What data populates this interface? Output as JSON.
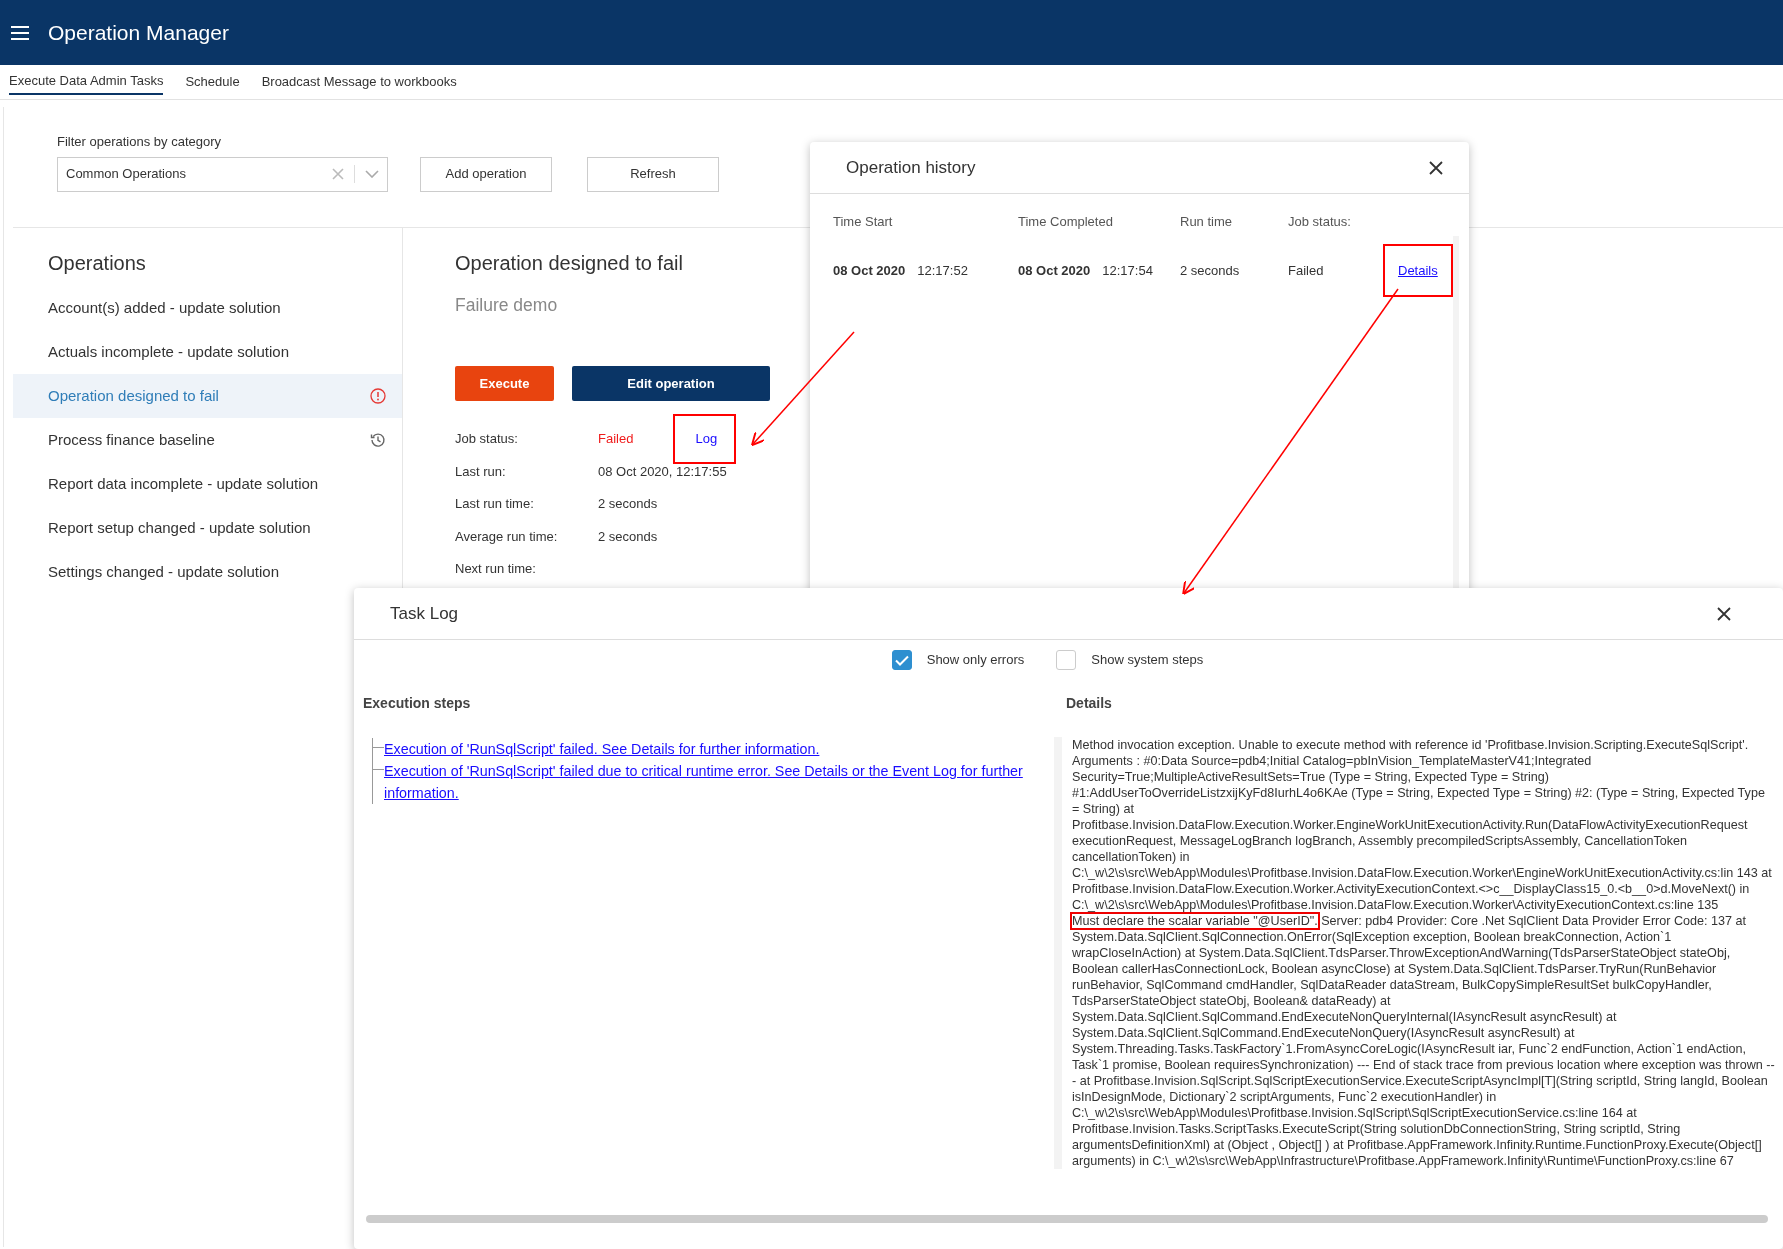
{
  "app": {
    "title": "Operation Manager"
  },
  "tabs": [
    {
      "label": "Execute Data Admin Tasks",
      "selected": true
    },
    {
      "label": "Schedule",
      "selected": false
    },
    {
      "label": "Broadcast Message to workbooks",
      "selected": false
    }
  ],
  "filter": {
    "label": "Filter operations by category",
    "value": "Common Operations"
  },
  "toolbar_buttons": [
    "Add operation",
    "Refresh"
  ],
  "operations": {
    "title": "Operations",
    "items": [
      {
        "label": "Account(s) added - update solution",
        "selected": false,
        "kind": "plain"
      },
      {
        "label": "Actuals incomplete - update solution",
        "selected": false,
        "kind": "plain"
      },
      {
        "label": "Operation designed to fail",
        "selected": true,
        "kind": "error"
      },
      {
        "label": "Process finance baseline",
        "selected": false,
        "kind": "history"
      },
      {
        "label": "Report data incomplete - update solution",
        "selected": false,
        "kind": "plain"
      },
      {
        "label": "Report setup changed - update solution",
        "selected": false,
        "kind": "plain"
      },
      {
        "label": "Settings changed - update solution",
        "selected": false,
        "kind": "plain"
      }
    ]
  },
  "detail": {
    "title": "Operation designed to fail",
    "subtitle": "Failure demo",
    "buttons": [
      {
        "label": "Execute",
        "kind": "danger"
      },
      {
        "label": "Edit operation",
        "kind": "primary"
      }
    ],
    "info": [
      {
        "label": "Job status:",
        "value": "Failed",
        "kind": "status"
      },
      {
        "label": "Last run:",
        "value": "08 Oct 2020, 12:17:55",
        "kind": "text"
      },
      {
        "label": "Last run time:",
        "value": "2 seconds",
        "kind": "text"
      },
      {
        "label": "Average run time:",
        "value": "2 seconds",
        "kind": "text"
      },
      {
        "label": "Next run time:",
        "kind": "text"
      }
    ],
    "log_link": {
      "label": "Log",
      "highlighted": true
    }
  },
  "history": {
    "title": "Operation history",
    "columns": [
      "Time Start",
      "Time Completed",
      "Run time",
      "Job status:"
    ],
    "rows": [
      {
        "start_date": "08 Oct 2020",
        "start_time": "12:17:52",
        "end_date": "08 Oct 2020",
        "end_time": "12:17:54",
        "run_time": "2 seconds",
        "status": "Failed",
        "link": "Details",
        "highlighted": true
      }
    ]
  },
  "task_log": {
    "title": "Task Log",
    "options": [
      {
        "label": "Show only errors",
        "checked": true
      },
      {
        "label": "Show system steps",
        "checked": false
      }
    ],
    "steps_title": "Execution steps",
    "steps": [
      "Execution of 'RunSqlScript' failed. See Details for further information.",
      "Execution of 'RunSqlScript' failed due to critical runtime error. See Details or the Event Log for further information."
    ],
    "details_title": "Details",
    "details": [
      {
        "text": "Method invocation exception. Unable to execute method with reference id 'Profitbase.Invision.Scripting.ExecuteSqlScript'. Arguments : #0:Data Source=pdb4;Initial Catalog=pbInVision_TemplateMasterV41;Integrated Security=True;MultipleActiveResultSets=True (Type = String, Expected Type = String) #1:AddUserToOverrideListzxijKyFd8IurhL4o6KAe (Type = String, Expected Type = String) #2: (Type = String, Expected Type = String) at Profitbase.Invision.DataFlow.Execution.Worker.EngineWorkUnitExecutionActivity.Run(DataFlowActivityExecutionRequest executionRequest, MessageLogBranch logBranch, Assembly precompiledScriptsAssembly, CancellationToken cancellationToken) in C:\\_w\\2\\s\\src\\WebApp\\Modules\\Profitbase.Invision.DataFlow.Execution.Worker\\EngineWorkUnitExecutionActivity.cs:lin 143 at Profitbase.Invision.DataFlow.Execution.Worker.ActivityExecutionContext.<>c__DisplayClass15_0.<b__0>d.MoveNext() in C:\\_w\\2\\s\\src\\WebApp\\Modules\\Profitbase.Invision.DataFlow.Execution.Worker\\ActivityExecutionContext.cs:line 135 ",
        "highlighted": false
      },
      {
        "text": "Must declare the scalar variable \"@UserID\".",
        "highlighted": true
      },
      {
        "text": " Server: pdb4 Provider: Core .Net SqlClient Data Provider Error Code: 137 at System.Data.SqlClient.SqlConnection.OnError(SqlException exception, Boolean breakConnection, Action`1 wrapCloseInAction) at System.Data.SqlClient.TdsParser.ThrowExceptionAndWarning(TdsParserStateObject stateObj, Boolean callerHasConnectionLock, Boolean asyncClose) at System.Data.SqlClient.TdsParser.TryRun(RunBehavior runBehavior, SqlCommand cmdHandler, SqlDataReader dataStream, BulkCopySimpleResultSet bulkCopyHandler, TdsParserStateObject stateObj, Boolean& dataReady) at System.Data.SqlClient.SqlCommand.EndExecuteNonQueryInternal(IAsyncResult asyncResult) at System.Data.SqlClient.SqlCommand.EndExecuteNonQuery(IAsyncResult asyncResult) at System.Threading.Tasks.TaskFactory`1.FromAsyncCoreLogic(IAsyncResult iar, Func`2 endFunction, Action`1 endAction, Task`1 promise, Boolean requiresSynchronization) --- End of stack trace from previous location where exception was thrown --- at Profitbase.Invision.SqlScript.SqlScriptExecutionService.ExecuteScriptAsyncImpl[T](String scriptId, String langId, Boolean isInDesignMode, Dictionary`2 scriptArguments, Func`2 executionHandler) in C:\\_w\\2\\s\\src\\WebApp\\Modules\\Profitbase.Invision.SqlScript\\SqlScriptExecutionService.cs:line 164 at Profitbase.Invision.Tasks.ScriptTasks.ExecuteScript(String solutionDbConnectionString, String scriptId, String argumentsDefinitionXml) at (Object , Object[] ) at Profitbase.AppFramework.Infinity.Runtime.FunctionProxy.Execute(Object[] arguments) in C:\\_w\\2\\s\\src\\WebApp\\Infrastructure\\Profitbase.AppFramework.Infinity\\Runtime\\FunctionProxy.cs:line 67",
        "highlighted": false
      }
    ]
  }
}
